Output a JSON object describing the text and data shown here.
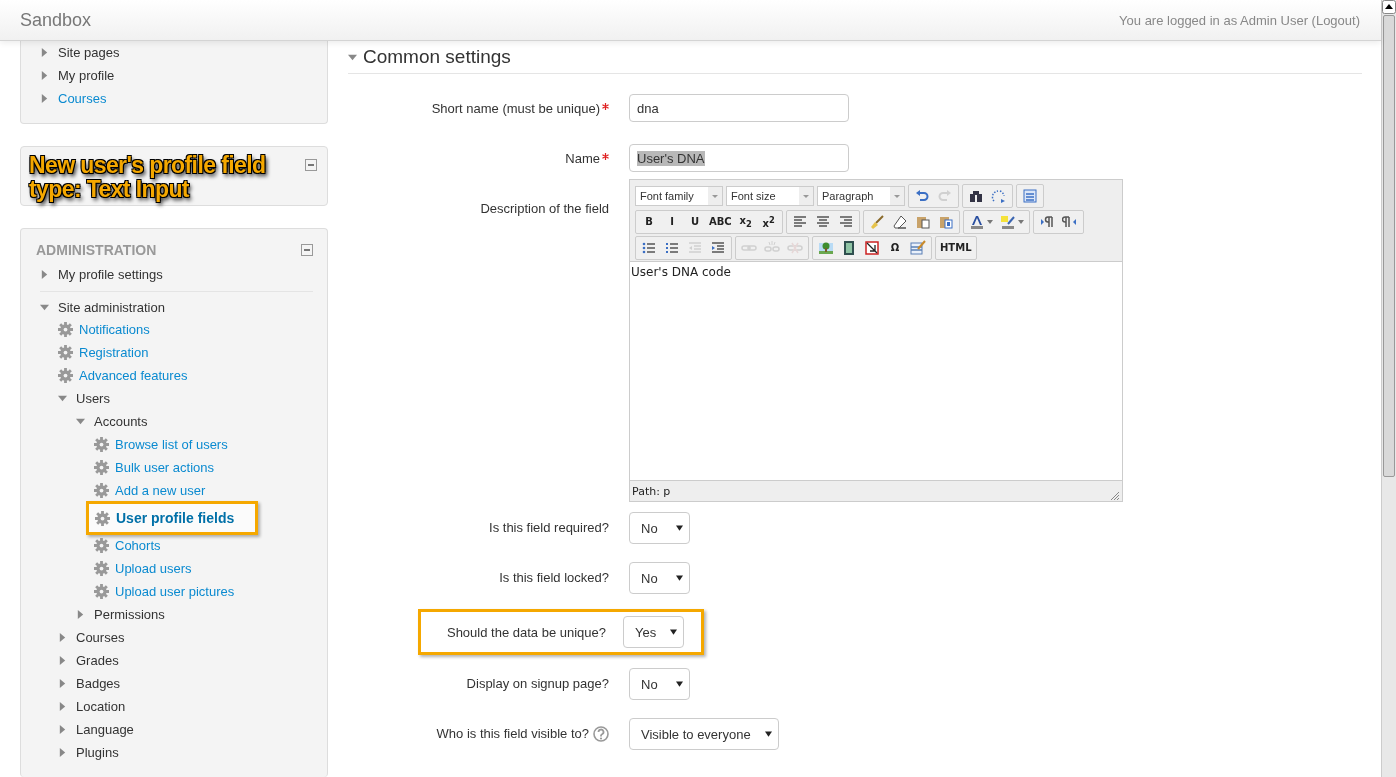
{
  "header": {
    "site_name": "Sandbox",
    "login_text": "You are logged in as Admin User (Logout)"
  },
  "navigation_block": {
    "items": [
      {
        "label": "Site pages",
        "kind": "folder",
        "link": false,
        "expanded": false
      },
      {
        "label": "My profile",
        "kind": "folder",
        "link": false,
        "expanded": false
      },
      {
        "label": "Courses",
        "kind": "folder",
        "link": true,
        "expanded": false
      }
    ]
  },
  "annotation_block": {
    "annotation": "New user's profile field type: Text Input"
  },
  "administration_block": {
    "title": "ADMINISTRATION",
    "items": [
      {
        "label": "My profile settings",
        "kind": "folder",
        "link": false,
        "expanded": false
      },
      {
        "label": "Site administration",
        "kind": "folder",
        "link": false,
        "expanded": true,
        "children": [
          {
            "label": "Notifications",
            "kind": "setting",
            "link": true
          },
          {
            "label": "Registration",
            "kind": "setting",
            "link": true
          },
          {
            "label": "Advanced features",
            "kind": "setting",
            "link": true
          },
          {
            "label": "Users",
            "kind": "folder",
            "link": false,
            "expanded": true,
            "children": [
              {
                "label": "Accounts",
                "kind": "folder",
                "link": false,
                "expanded": true,
                "children": [
                  {
                    "label": "Browse list of users",
                    "kind": "setting",
                    "link": true,
                    "highlighted": false
                  },
                  {
                    "label": "Bulk user actions",
                    "kind": "setting",
                    "link": true,
                    "highlighted": false
                  },
                  {
                    "label": "Add a new user",
                    "kind": "setting",
                    "link": true,
                    "highlighted": false
                  },
                  {
                    "label": "User profile fields",
                    "kind": "setting",
                    "link": true,
                    "highlighted": true
                  },
                  {
                    "label": "Cohorts",
                    "kind": "setting",
                    "link": true,
                    "highlighted": false
                  },
                  {
                    "label": "Upload users",
                    "kind": "setting",
                    "link": true,
                    "highlighted": false
                  },
                  {
                    "label": "Upload user pictures",
                    "kind": "setting",
                    "link": true,
                    "highlighted": false
                  }
                ]
              },
              {
                "label": "Permissions",
                "kind": "folder",
                "link": false,
                "expanded": false
              }
            ]
          },
          {
            "label": "Courses",
            "kind": "folder",
            "link": false,
            "expanded": false
          },
          {
            "label": "Grades",
            "kind": "folder",
            "link": false,
            "expanded": false
          },
          {
            "label": "Badges",
            "kind": "folder",
            "link": false,
            "expanded": false
          },
          {
            "label": "Location",
            "kind": "folder",
            "link": false,
            "expanded": false
          },
          {
            "label": "Language",
            "kind": "folder",
            "link": false,
            "expanded": false
          },
          {
            "label": "Plugins",
            "kind": "folder",
            "link": false,
            "expanded": false
          }
        ]
      }
    ]
  },
  "section": {
    "title": "Common settings",
    "expanded": true
  },
  "form_rows": [
    {
      "kind": "text",
      "label": "Short name (must be unique)",
      "required": true,
      "help": false,
      "highlighted": false,
      "value": "dna",
      "value_selected": false
    },
    {
      "kind": "text",
      "label": "Name",
      "required": true,
      "help": false,
      "highlighted": false,
      "value": "User's DNA",
      "value_selected": true
    },
    {
      "kind": "editor",
      "label": "Description of the field",
      "required": false,
      "help": false,
      "highlighted": false,
      "editor": {
        "dropdowns": [
          "Font family",
          "Font size",
          "Paragraph"
        ],
        "toolbar_rows": [
          [
            [
              {
                "kind": "undo",
                "disabled": false
              },
              {
                "kind": "redo",
                "disabled": true
              }
            ],
            [
              {
                "kind": "find",
                "disabled": false
              },
              {
                "kind": "replace",
                "disabled": false
              }
            ],
            [
              {
                "kind": "fullscreen",
                "disabled": false
              }
            ]
          ],
          [
            [
              {
                "kind": "glyph",
                "label": "B",
                "disabled": false
              },
              {
                "kind": "glyph",
                "label": "I",
                "disabled": false
              },
              {
                "kind": "glyph",
                "label": "U",
                "disabled": false
              },
              {
                "kind": "glyph",
                "label": "ABC",
                "disabled": false
              },
              {
                "kind": "glyph",
                "label": "x$_{2}$",
                "disabled": false
              },
              {
                "kind": "glyph",
                "label": "x$^{2}$",
                "disabled": false
              }
            ],
            [
              {
                "kind": "align-left",
                "disabled": false
              },
              {
                "kind": "align-center",
                "disabled": false
              },
              {
                "kind": "align-right",
                "disabled": false
              }
            ],
            [
              {
                "kind": "cleanup",
                "disabled": false
              },
              {
                "kind": "eraser",
                "disabled": false
              },
              {
                "kind": "paste-text",
                "disabled": false
              },
              {
                "kind": "paste-word",
                "disabled": false
              }
            ],
            [
              {
                "kind": "text-color",
                "disabled": false
              },
              {
                "kind": "highlight",
                "disabled": false
              }
            ],
            [
              {
                "kind": "ltr",
                "disabled": false
              },
              {
                "kind": "rtl",
                "disabled": false
              }
            ]
          ],
          [
            [
              {
                "kind": "bullets",
                "disabled": false
              },
              {
                "kind": "numbers",
                "disabled": false
              },
              {
                "kind": "outdent",
                "disabled": true
              },
              {
                "kind": "indent",
                "disabled": false
              }
            ],
            [
              {
                "kind": "link",
                "disabled": true
              },
              {
                "kind": "unlink",
                "disabled": true
              },
              {
                "kind": "anchor",
                "disabled": true
              }
            ],
            [
              {
                "kind": "image",
                "disabled": false
              },
              {
                "kind": "media",
                "disabled": false
              },
              {
                "kind": "nonbreak",
                "disabled": false
              },
              {
                "kind": "glyph",
                "label": "Ω",
                "disabled": false
              },
              {
                "kind": "table",
                "disabled": false
              }
            ],
            [
              {
                "kind": "glyph",
                "label": "HTML",
                "disabled": false
              }
            ]
          ]
        ],
        "content": "User's DNA code",
        "path": "Path: p"
      }
    },
    {
      "kind": "select",
      "label": "Is this field required?",
      "required": false,
      "help": false,
      "highlighted": false,
      "value": "No"
    },
    {
      "kind": "select",
      "label": "Is this field locked?",
      "required": false,
      "help": false,
      "highlighted": false,
      "value": "No"
    },
    {
      "kind": "select",
      "label": "Should the data be unique?",
      "required": false,
      "help": false,
      "highlighted": true,
      "value": "Yes"
    },
    {
      "kind": "select",
      "label": "Display on signup page?",
      "required": false,
      "help": false,
      "highlighted": false,
      "value": "No"
    },
    {
      "kind": "select",
      "label": "Who is this field visible to?",
      "required": false,
      "help": true,
      "highlighted": false,
      "value": "Visible to everyone"
    }
  ]
}
